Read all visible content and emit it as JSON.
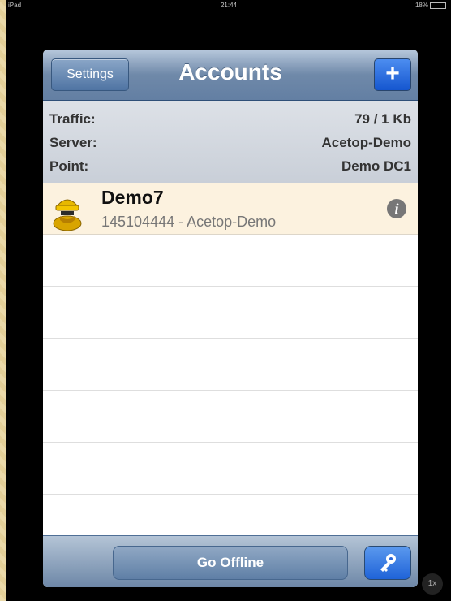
{
  "statusbar": {
    "device": "iPad",
    "time": "21:44",
    "battery": "18%"
  },
  "navbar": {
    "back_label": "Settings",
    "title": "Accounts",
    "add_label": "+"
  },
  "info": {
    "traffic_label": "Traffic:",
    "traffic_value": "79 / 1 Kb",
    "server_label": "Server:",
    "server_value": "Acetop-Demo",
    "point_label": "Point:",
    "point_value": "Demo DC1"
  },
  "accounts": [
    {
      "name": "Demo7",
      "detail": "145104444 - Acetop-Demo",
      "icon": "spy-avatar-icon",
      "info_icon": "info-icon"
    }
  ],
  "bottombar": {
    "offline_label": "Go Offline",
    "key_icon": "key-icon"
  },
  "zoom_label": "1x"
}
